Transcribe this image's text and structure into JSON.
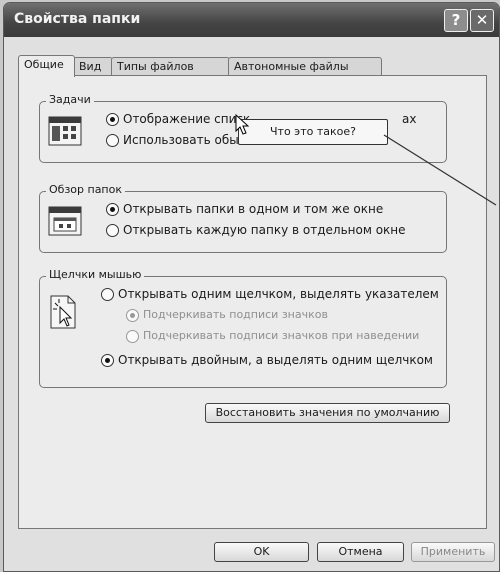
{
  "window": {
    "title": "Свойства папки",
    "help_glyph": "?",
    "close_glyph": "✕"
  },
  "tabs": [
    {
      "label": "Общие",
      "active": true
    },
    {
      "label": "Вид",
      "active": false
    },
    {
      "label": "Типы файлов",
      "active": false
    },
    {
      "label": "Автономные файлы",
      "active": false
    }
  ],
  "groups": {
    "tasks": {
      "title": "Задачи",
      "icon": "tasks-folder-icon",
      "options": [
        {
          "label": "Отображение списк",
          "label_tail": "ах",
          "checked": true
        },
        {
          "label": "Использовать обыч",
          "checked": false
        }
      ]
    },
    "browse": {
      "title": "Обзор папок",
      "icon": "browse-folders-icon",
      "options": [
        {
          "label": "Открывать папки в одном и том же окне",
          "checked": true
        },
        {
          "label": "Открывать каждую папку в отдельном окне",
          "checked": false
        }
      ]
    },
    "clicks": {
      "title": "Щелчки мышью",
      "icon": "mouse-click-icon",
      "options": [
        {
          "label": "Открывать одним щелчком, выделять указателем",
          "checked": false
        },
        {
          "label": "Подчеркивать подписи значков",
          "checked": true,
          "disabled": true
        },
        {
          "label": "Подчеркивать подписи значков при наведении",
          "checked": false,
          "disabled": true
        },
        {
          "label": "Открывать двойным, а выделять одним щелчком",
          "checked": true
        }
      ]
    }
  },
  "restore_button": "Восстановить значения по умолчанию",
  "tooltip": {
    "text": "Что это такое?"
  },
  "footer": {
    "ok": "OK",
    "cancel": "Отмена",
    "apply": "Применить"
  },
  "colors": {
    "titlebar": "#444444",
    "panel": "#ececec",
    "border": "#777777"
  }
}
